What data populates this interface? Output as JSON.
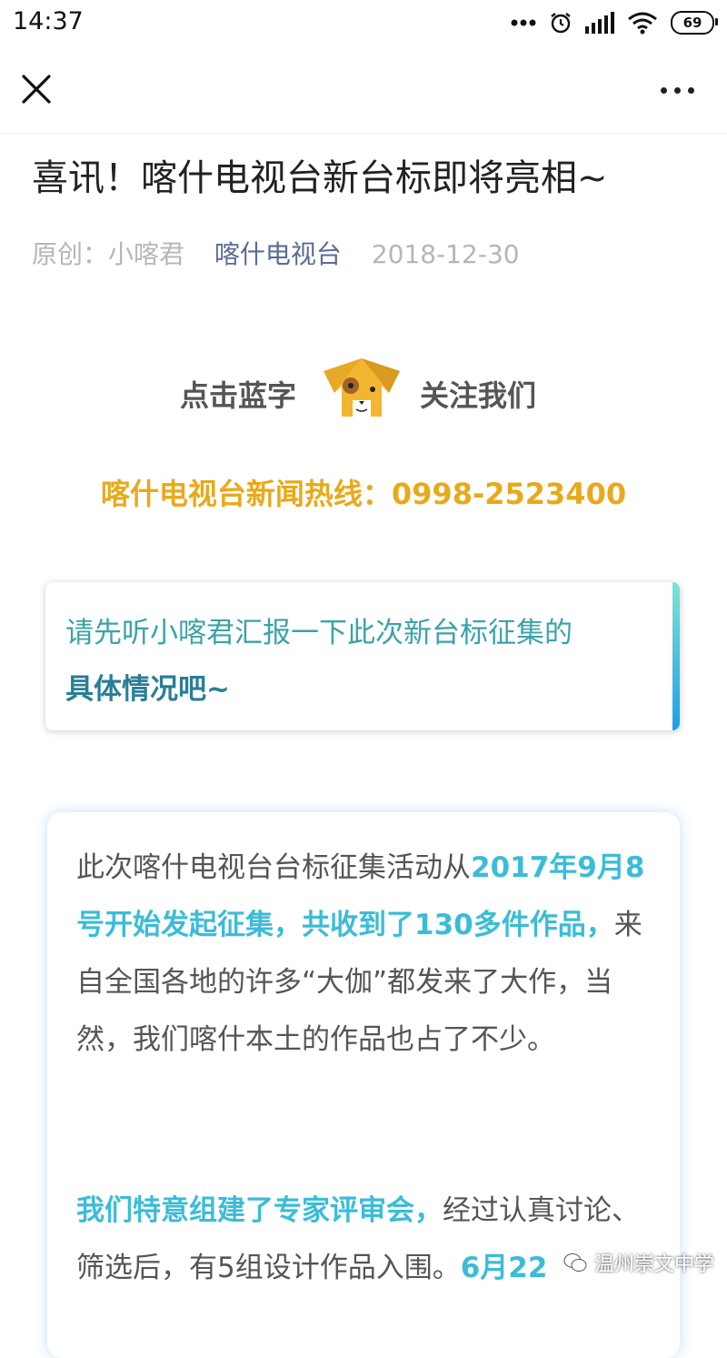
{
  "status_bar": {
    "time": "14:37",
    "battery": "69"
  },
  "nav": {
    "close_icon": "close-icon",
    "more_icon": "more-dots-icon"
  },
  "article": {
    "title": "喜讯！喀什电视台新台标即将亮相~",
    "meta": {
      "original": "原创：小喀君",
      "account": "喀什电视台",
      "date": "2018-12-30"
    }
  },
  "follow": {
    "left_text": "点击蓝字",
    "right_text": "关注我们",
    "mascot_icon": "dog-mascot-icon"
  },
  "hotline": "喀什电视台新闻热线：0998-2523400",
  "quote": {
    "line1": "请先听小喀君汇报一下此次新台标征集的",
    "line2": "具体情况吧~"
  },
  "content": {
    "p1_a": "此次喀什电视台台标征集活动从",
    "p1_hl": "2017年9月8号开始发起征集，共收到了130多件作品，",
    "p1_b": "来自全国各地的许多“大伽”都发来了大作，当然，我们喀什本土的作品也占了不少。",
    "p2_hl": "我们特意组建了专家评审会，",
    "p2_a": "经过认真讨论、筛选后，有5组设计作品入围。",
    "p2_hl2": "6月22"
  },
  "watermark": "温州崇文中学",
  "colors": {
    "accent_blue": "#3bbcd8",
    "hotline_gold": "#e8a91a",
    "account_link": "#586c94"
  }
}
